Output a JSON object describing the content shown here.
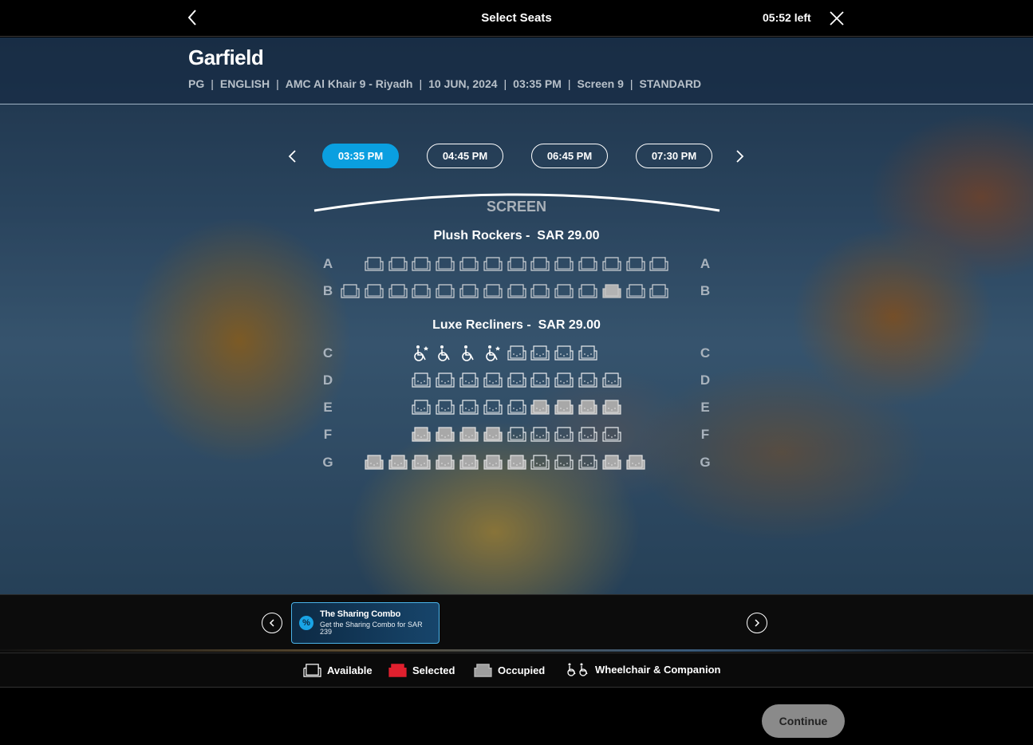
{
  "header": {
    "title": "Select Seats",
    "timer": "05:52 left"
  },
  "movie": {
    "title": "Garfield",
    "meta": [
      "PG",
      "ENGLISH",
      "AMC Al Khair 9 - Riyadh",
      "10 JUN, 2024",
      "03:35 PM",
      "Screen 9",
      "STANDARD"
    ]
  },
  "showtimes": {
    "times": [
      "03:35 PM",
      "04:45 PM",
      "06:45 PM",
      "07:30 PM"
    ],
    "selected": "03:35 PM"
  },
  "screen_label": "SCREEN",
  "sections": [
    {
      "name": "Plush Rockers -",
      "currency": "SAR",
      "price": "29.00",
      "rows": [
        {
          "label": "A",
          "seats": [
            "A",
            "A",
            "A",
            "A",
            "A",
            "A",
            "A",
            "A",
            "A",
            "A",
            "A",
            "A",
            "A"
          ],
          "start": 1
        },
        {
          "label": "B",
          "seats": [
            "A",
            "A",
            "A",
            "A",
            "A",
            "A",
            "A",
            "A",
            "A",
            "A",
            "A",
            "O",
            "A",
            "A"
          ],
          "start": 0
        }
      ]
    },
    {
      "name": "Luxe Recliners -",
      "currency": "SAR",
      "price": "29.00",
      "rows": [
        {
          "label": "C",
          "seats": [
            "W",
            "C",
            "C",
            "W",
            "R",
            "R",
            "R",
            "R"
          ],
          "start": 3
        },
        {
          "label": "D",
          "seats": [
            "R",
            "R",
            "R",
            "R",
            "R",
            "R",
            "R",
            "R",
            "R"
          ],
          "start": 3
        },
        {
          "label": "E",
          "seats": [
            "R",
            "R",
            "R",
            "R",
            "R",
            "RO",
            "RO",
            "RO",
            "RO"
          ],
          "start": 3
        },
        {
          "label": "F",
          "seats": [
            "RO",
            "RO",
            "RO",
            "RO",
            "R",
            "R",
            "R",
            "R",
            "R"
          ],
          "start": 3
        },
        {
          "label": "G",
          "seats": [
            "RO",
            "RO",
            "RO",
            "RO",
            "RO",
            "RO",
            "RO",
            "R",
            "R",
            "R",
            "RO",
            "RO"
          ],
          "start": 1
        }
      ]
    }
  ],
  "promo": {
    "title": "The Sharing Combo",
    "subtitle": "Get the Sharing Combo for SAR 239",
    "icon": "%"
  },
  "legend": {
    "available": "Available",
    "selected": "Selected",
    "occupied": "Occupied",
    "wheelchair": "Wheelchair & Companion"
  },
  "colors": {
    "accent": "#0a9fe0",
    "selected_seat": "#e0202e",
    "occupied_seat": "#bdbdbd"
  },
  "footer": {
    "continue_label": "Continue"
  }
}
